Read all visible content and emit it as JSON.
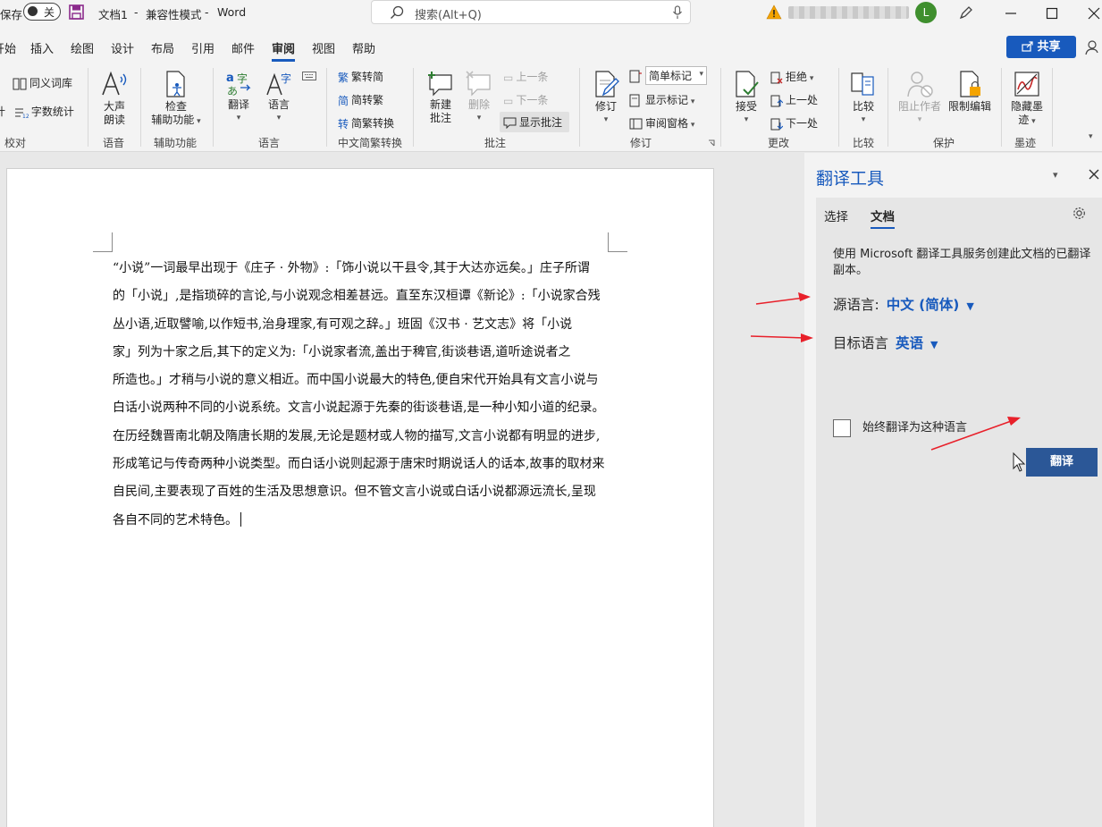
{
  "titlebar": {
    "autosave_label": "保存",
    "autosave_state": "关",
    "doc_name": "文档1",
    "separator": "-",
    "mode": "兼容性模式",
    "app": "Word",
    "search_placeholder": "搜索(Alt+Q)",
    "user_initial": "L"
  },
  "tabs": [
    "开始",
    "插入",
    "绘图",
    "设计",
    "布局",
    "引用",
    "邮件",
    "审阅",
    "视图",
    "帮助"
  ],
  "active_tab": "审阅",
  "share_label": "共享",
  "ribbon": {
    "proofing": {
      "label": "校对",
      "thesaurus": "同义词库",
      "word_count": "字数统计"
    },
    "speech": {
      "label": "语音",
      "read_aloud_1": "大声",
      "read_aloud_2": "朗读"
    },
    "accessibility": {
      "label": "辅助功能",
      "check_1": "检查",
      "check_2": "辅助功能"
    },
    "language": {
      "label": "语言",
      "translate": "翻译",
      "language": "语言"
    },
    "chinese_conversion": {
      "label": "中文简繁转换",
      "to_simplified": "繁转简",
      "to_traditional": "简转繁",
      "convert": "简繁转换"
    },
    "comments": {
      "label": "批注",
      "new_1": "新建",
      "new_2": "批注",
      "delete": "删除",
      "previous": "上一条",
      "next": "下一条",
      "show": "显示批注"
    },
    "tracking": {
      "label": "修订",
      "track": "修订",
      "markup_option": "简单标记",
      "show_markup": "显示标记",
      "reviewing_pane": "审阅窗格"
    },
    "changes": {
      "label": "更改",
      "accept": "接受",
      "reject": "拒绝",
      "previous": "上一处",
      "next": "下一处"
    },
    "compare": {
      "label": "比较",
      "compare": "比较"
    },
    "protect": {
      "label": "保护",
      "block_authors": "阻止作者",
      "restrict_editing": "限制编辑"
    },
    "ink": {
      "label": "墨迹",
      "hide_ink_1": "隐藏墨",
      "hide_ink_2": "迹"
    }
  },
  "document": {
    "lines": [
      "“小说”一词最早出现于《庄子 · 外物》:「饰小说以干县令,其于大达亦远矣。」庄子所谓",
      "的「小说」,是指琐碎的言论,与小说观念相差甚远。直至东汉桓谭《新论》:「小说家合残",
      "丛小语,近取譬喻,以作短书,治身理家,有可观之辞。」班固《汉书 · 艺文志》将「小说",
      "家」列为十家之后,其下的定义为:「小说家者流,盖出于稗官,街谈巷语,道听途说者之",
      "所造也。」才稍与小说的意义相近。而中国小说最大的特色,便自宋代开始具有文言小说与",
      "白话小说两种不同的小说系统。文言小说起源于先秦的街谈巷语,是一种小知小道的纪录。",
      "在历经魏晋南北朝及隋唐长期的发展,无论是题材或人物的描写,文言小说都有明显的进步,",
      "形成笔记与传奇两种小说类型。而白话小说则起源于唐宋时期说话人的话本,故事的取材来",
      "自民间,主要表现了百姓的生活及思想意识。但不管文言小说或白话小说都源远流长,呈现",
      "各自不同的艺术特色。"
    ]
  },
  "translator": {
    "title": "翻译工具",
    "tab_selection": "选择",
    "tab_document": "文档",
    "description": "使用 Microsoft 翻译工具服务创建此文档的已翻译副本。",
    "source_label": "源语言:",
    "source_value": "中文 (简体)",
    "target_label": "目标语言",
    "target_value": "英语",
    "always_translate": "始终翻译为这种语言",
    "translate_button": "翻译"
  },
  "colors": {
    "accent": "#185abd",
    "button": "#2b5797",
    "arrow": "#e8202a"
  }
}
